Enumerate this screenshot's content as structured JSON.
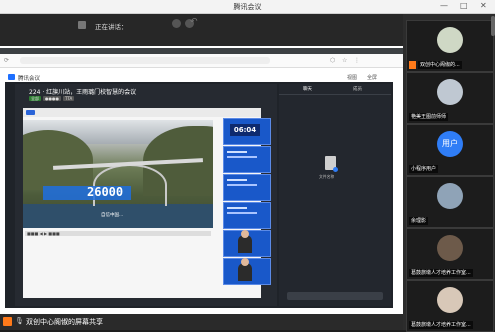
{
  "app": {
    "title": "腾讯会议"
  },
  "window_controls": {
    "minimize": "—",
    "maximize": "□",
    "close": "✕"
  },
  "speaking": {
    "label": "正在讲话："
  },
  "shared": {
    "inner_app_title": "腾讯会议",
    "inner_bar_labels": [
      "视图",
      "全屏"
    ],
    "meeting_title": "224 · 红旗川站，王雨璐门校智慧的会议",
    "tags": [
      "全部",
      "●●●●",
      "TTA"
    ],
    "slide_number": "26000",
    "slide_caption": "自信中国...",
    "timer": "06:04",
    "controls_text": "■■■ ◀ ▶ ■■■",
    "right_tabs": [
      "聊天",
      "成员"
    ],
    "file_name": "文件名称"
  },
  "bottom": {
    "share_label": "双创中心阁俶的屏幕共享"
  },
  "participants": [
    {
      "name": "双创中心阁俶的...",
      "avatar": "photo"
    },
    {
      "name": "艳美王图前师师",
      "avatar": "photo"
    },
    {
      "name": "小程序用户",
      "avatar": "text",
      "avatar_text": "用户"
    },
    {
      "name": "余理影",
      "avatar": "photo"
    },
    {
      "name": "葛鼓旅墩人才培养工作室...",
      "avatar": "photo"
    },
    {
      "name": "葛鼓旅墩人才培养工作室...",
      "avatar": "photo"
    }
  ],
  "colors": {
    "accent": "#2f7df6",
    "brand_orange": "#ff7a1a",
    "bg_dark": "#1e1e1e"
  }
}
